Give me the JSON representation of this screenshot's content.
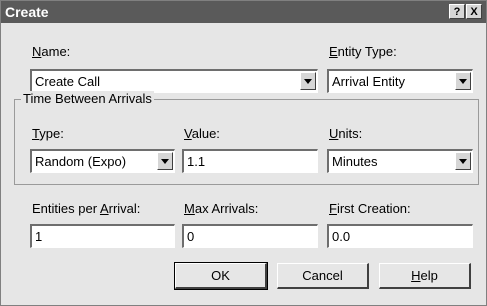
{
  "title": "Create",
  "titlebar": {
    "help_glyph": "?",
    "close_glyph": "X"
  },
  "name": {
    "label_prefix": "",
    "label_mnemonic": "N",
    "label_rest": "ame:",
    "value": "Create Call"
  },
  "entity_type": {
    "label_mnemonic": "E",
    "label_rest": "ntity Type:",
    "value": "Arrival Entity"
  },
  "group": {
    "title": "Time Between Arrivals"
  },
  "type": {
    "label_mnemonic": "T",
    "label_rest": "ype:",
    "value": "Random (Expo)"
  },
  "value": {
    "label_mnemonic": "V",
    "label_rest": "alue:",
    "value": "1.1"
  },
  "units": {
    "label_mnemonic": "U",
    "label_rest": "nits:",
    "value": "Minutes"
  },
  "entities_per_arrival": {
    "label_prefix": "Entities per ",
    "label_mnemonic": "A",
    "label_rest": "rrival:",
    "value": "1"
  },
  "max_arrivals": {
    "label_mnemonic": "M",
    "label_rest": "ax Arrivals:",
    "value": "0"
  },
  "first_creation": {
    "label_mnemonic": "F",
    "label_rest": "irst Creation:",
    "value": "0.0"
  },
  "buttons": {
    "ok": "OK",
    "cancel": "Cancel",
    "help_mnemonic": "H",
    "help_rest": "elp"
  }
}
